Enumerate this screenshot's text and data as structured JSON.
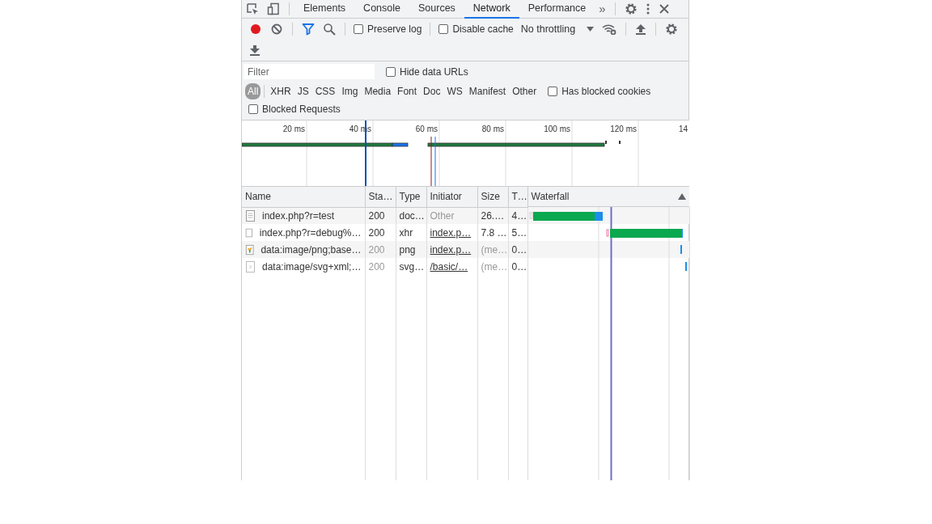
{
  "tabs": [
    {
      "label": "Elements",
      "selected": false
    },
    {
      "label": "Console",
      "selected": false
    },
    {
      "label": "Sources",
      "selected": false
    },
    {
      "label": "Network",
      "selected": true
    },
    {
      "label": "Performance",
      "selected": false
    }
  ],
  "more_tabs": "»",
  "toolbar": {
    "recording": true,
    "filter_active": true,
    "preserve_log": {
      "label": "Preserve log",
      "checked": false
    },
    "disable_cache": {
      "label": "Disable cache",
      "checked": false
    },
    "throttling": "No throttling"
  },
  "filter_bar": {
    "placeholder": "Filter",
    "hide_data_urls": {
      "label": "Hide data URLs",
      "checked": false
    },
    "types": [
      {
        "label": "All",
        "selected": true
      },
      {
        "label": "XHR",
        "selected": false
      },
      {
        "label": "JS",
        "selected": false
      },
      {
        "label": "CSS",
        "selected": false
      },
      {
        "label": "Img",
        "selected": false
      },
      {
        "label": "Media",
        "selected": false
      },
      {
        "label": "Font",
        "selected": false
      },
      {
        "label": "Doc",
        "selected": false
      },
      {
        "label": "WS",
        "selected": false
      },
      {
        "label": "Manifest",
        "selected": false
      },
      {
        "label": "Other",
        "selected": false
      }
    ],
    "has_blocked_cookies": {
      "label": "Has blocked cookies",
      "checked": false
    },
    "blocked_requests": {
      "label": "Blocked Requests",
      "checked": false
    }
  },
  "overview": {
    "ticks": [
      "20 ms",
      "40 ms",
      "60 ms",
      "80 ms",
      "100 ms",
      "120 ms",
      "14"
    ]
  },
  "table": {
    "columns": [
      "Name",
      "Sta…",
      "Type",
      "Initiator",
      "Size",
      "T…",
      "Waterfall"
    ],
    "rows": [
      {
        "name": "index.php?r=test",
        "kind": "document",
        "status": "200",
        "status_dimmed": false,
        "type": "doc…",
        "initiator": "Other",
        "initiator_is_link": false,
        "size": "26.…",
        "size_dimmed": false,
        "time": "4…"
      },
      {
        "name": "index.php?r=debug%…",
        "kind": "blank",
        "status": "200",
        "status_dimmed": false,
        "type": "xhr",
        "initiator": "index.p…",
        "initiator_is_link": true,
        "size": "7.8 …",
        "size_dimmed": false,
        "time": "5…"
      },
      {
        "name": "data:image/png;base…",
        "kind": "image",
        "status": "200",
        "status_dimmed": true,
        "type": "png",
        "initiator": "index.p…",
        "initiator_is_link": true,
        "size": "(me…",
        "size_dimmed": true,
        "time": "0…"
      },
      {
        "name": "data:image/svg+xml;…",
        "kind": "vector",
        "status": "200",
        "status_dimmed": true,
        "type": "svg…",
        "initiator": "/basic/…",
        "initiator_is_link": true,
        "size": "(me…",
        "size_dimmed": true,
        "time": "0…"
      }
    ]
  }
}
